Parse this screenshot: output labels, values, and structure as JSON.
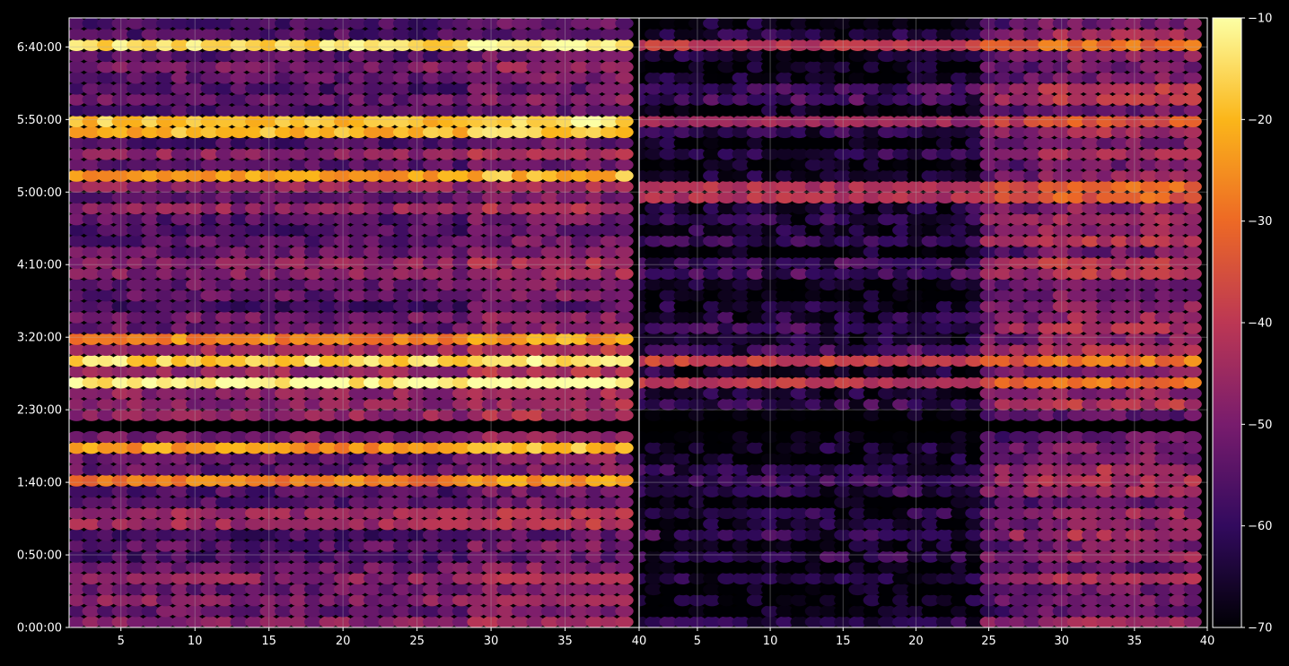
{
  "chart_data": [
    {
      "type": "heatmap",
      "title": "",
      "xlabel": "",
      "ylabel": "",
      "xlim": [
        1.5,
        40
      ],
      "ylim": [
        0,
        25200
      ],
      "x_ticks": [
        5,
        10,
        15,
        20,
        25,
        30,
        35,
        40
      ],
      "y_ticks": [
        {
          "value": 0,
          "label": "0:00:00"
        },
        {
          "value": 3000,
          "label": "0:50:00"
        },
        {
          "value": 6000,
          "label": "1:40:00"
        },
        {
          "value": 9000,
          "label": "2:30:00"
        },
        {
          "value": 12000,
          "label": "3:20:00"
        },
        {
          "value": 15000,
          "label": "4:10:00"
        },
        {
          "value": 18000,
          "label": "5:00:00"
        },
        {
          "value": 21000,
          "label": "5:50:00"
        },
        {
          "value": 24000,
          "label": "6:40:00"
        }
      ],
      "grid": true,
      "x_range": [
        2,
        39
      ],
      "row_count": 56,
      "hot_rows_db": [
        {
          "time": "6:40:00",
          "level": -20
        },
        {
          "time": "5:50:00",
          "level": -24
        },
        {
          "time": "5:45:00",
          "level": -26
        },
        {
          "time": "5:10:00",
          "level": -30
        },
        {
          "time": "3:20:00",
          "level": -32
        },
        {
          "time": "3:05:00",
          "level": -22
        },
        {
          "time": "2:50:00",
          "level": -18
        },
        {
          "time": "2:05:00",
          "level": -30
        },
        {
          "time": "1:40:00",
          "level": -34
        }
      ],
      "gap_time_range": [
        "2:15:00",
        "2:25:00"
      ]
    },
    {
      "type": "heatmap",
      "title": "",
      "xlabel": "",
      "ylabel": "",
      "xlim": [
        1,
        40
      ],
      "ylim": [
        0,
        25200
      ],
      "x_ticks": [
        5,
        10,
        15,
        20,
        25,
        30,
        35,
        40
      ],
      "grid": true,
      "x_range": [
        1,
        39
      ],
      "row_count": 56,
      "hot_rows_db": [
        {
          "time": "6:40:00",
          "level": -40
        },
        {
          "time": "5:50:00",
          "level": -45
        },
        {
          "time": "5:00:00",
          "level": -42
        },
        {
          "time": "3:05:00",
          "level": -38
        },
        {
          "time": "2:50:00",
          "level": -40
        }
      ],
      "gap_time_range": [
        "2:15:00",
        "2:25:00"
      ]
    }
  ],
  "colorbar": {
    "vmin": -70,
    "vmax": -10,
    "ticks": [
      -10,
      -20,
      -30,
      -40,
      -50,
      -60,
      -70
    ],
    "tick_labels": [
      "−10",
      "−20",
      "−30",
      "−40",
      "−50",
      "−60",
      "−70"
    ],
    "colormap": "inferno",
    "stops": [
      "#000004",
      "#320a5e",
      "#781c6d",
      "#bc3754",
      "#ed6925",
      "#fbb61a",
      "#fcffa4"
    ]
  },
  "colors": {
    "background": "#000000",
    "grid": "#b0b0b0",
    "spine": "#ffffff",
    "text": "#ffffff"
  }
}
